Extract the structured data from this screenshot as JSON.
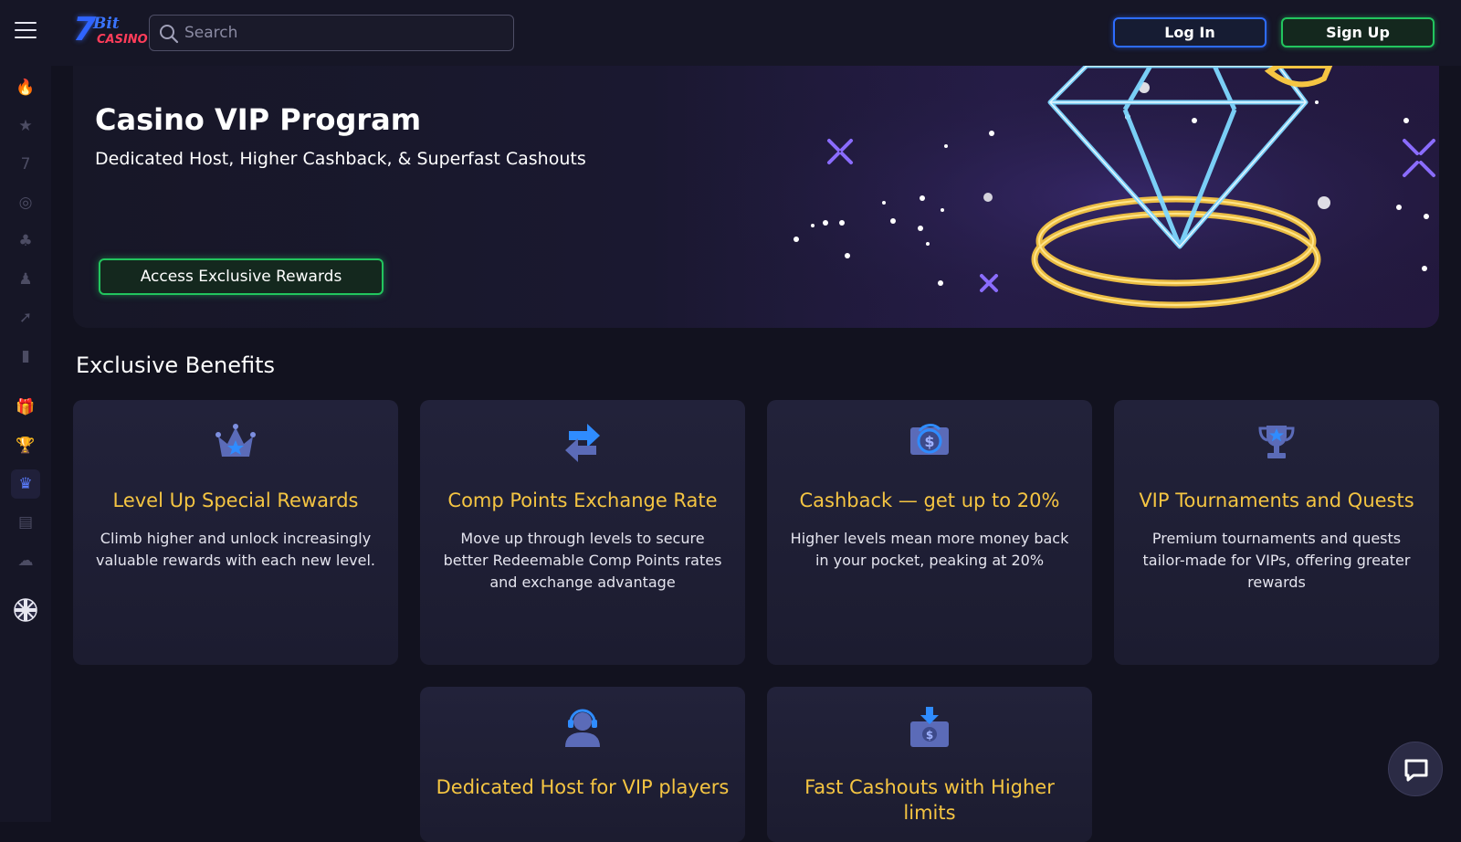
{
  "header": {
    "logo": {
      "number": "7",
      "bit": "Bit",
      "casino": "CASINO"
    },
    "search_placeholder": "Search",
    "login_label": "Log In",
    "signup_label": "Sign Up"
  },
  "sidebar": {
    "items": [
      {
        "name": "fire-icon",
        "glyph": "🔥"
      },
      {
        "name": "star-icon",
        "glyph": "★"
      },
      {
        "name": "seven-icon",
        "glyph": "7"
      },
      {
        "name": "roulette-icon",
        "glyph": "◎"
      },
      {
        "name": "cards-icon",
        "glyph": "♣"
      },
      {
        "name": "dealer-icon",
        "glyph": "♟"
      },
      {
        "name": "rocket-icon",
        "glyph": "➚"
      },
      {
        "name": "card-game-icon",
        "glyph": "▮"
      },
      {
        "name": "gift-icon",
        "glyph": "🎁"
      },
      {
        "name": "trophy-icon",
        "glyph": "🏆"
      },
      {
        "name": "vip-crown-icon",
        "glyph": "♛"
      },
      {
        "name": "wallet-icon",
        "glyph": "▤"
      },
      {
        "name": "support-icon",
        "glyph": "☁"
      }
    ],
    "language_flag": "☩"
  },
  "hero": {
    "title": "Casino VIP Program",
    "subtitle": "Dedicated Host, Higher Cashback, & Superfast Cashouts",
    "cta_label": "Access Exclusive Rewards"
  },
  "benefits": {
    "section_title": "Exclusive Benefits",
    "cards": [
      {
        "title": "Level Up Special Rewards",
        "description": "Climb higher and unlock increasingly valuable rewards with each new level.",
        "icon": "crown-star-icon"
      },
      {
        "title": "Comp Points Exchange Rate",
        "description": "Move up through levels to secure better Redeemable Comp Points rates and exchange advantage",
        "icon": "exchange-arrows-icon"
      },
      {
        "title": "Cashback — get up to 20%",
        "description": "Higher levels mean more money back in your pocket, peaking at 20%",
        "icon": "cashback-icon"
      },
      {
        "title": "VIP Tournaments and Quests",
        "description": "Premium tournaments and quests tailor-made for VIPs, offering greater rewards",
        "icon": "trophy-star-icon"
      },
      {
        "title": "Dedicated Host for VIP players",
        "description": "",
        "icon": "host-headset-icon"
      },
      {
        "title": "Fast Cashouts with Higher limits",
        "description": "",
        "icon": "cashout-icon"
      }
    ]
  },
  "colors": {
    "background": "#12121f",
    "card_title": "#f5c542",
    "login_border": "#2d6cff",
    "signup_border": "#22c55e"
  }
}
